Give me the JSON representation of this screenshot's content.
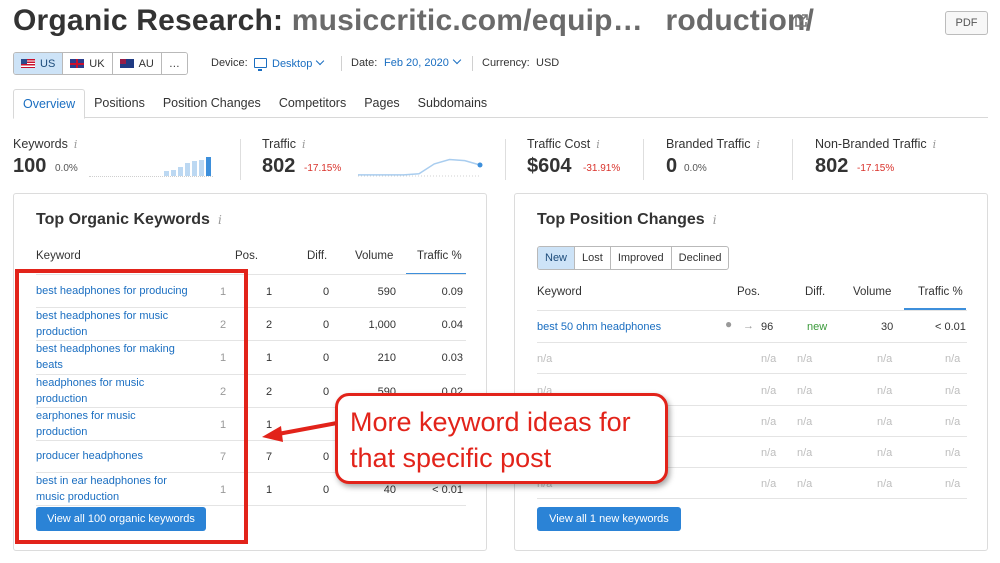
{
  "header": {
    "title_prefix": "Organic Research:",
    "title_domain": "musiccritic.com/equip…",
    "title_domain_end": "roduction/",
    "pdf_label": "PDF"
  },
  "filters": {
    "countries": [
      {
        "code": "US",
        "active": true
      },
      {
        "code": "UK",
        "active": false
      },
      {
        "code": "AU",
        "active": false
      },
      {
        "code": "…",
        "active": false
      }
    ],
    "device_label": "Device:",
    "device_value": "Desktop",
    "date_label": "Date:",
    "date_value": "Feb 20, 2020",
    "currency_label": "Currency:",
    "currency_value": "USD"
  },
  "tabs": [
    "Overview",
    "Positions",
    "Position Changes",
    "Competitors",
    "Pages",
    "Subdomains"
  ],
  "metrics": {
    "keywords": {
      "label": "Keywords",
      "value": "100",
      "delta": "0.0%"
    },
    "traffic": {
      "label": "Traffic",
      "value": "802",
      "delta": "-17.15%"
    },
    "traffic_cost": {
      "label": "Traffic Cost",
      "value": "$604",
      "delta": "-31.91%"
    },
    "branded": {
      "label": "Branded Traffic",
      "value": "0",
      "delta": "0.0%"
    },
    "non_branded": {
      "label": "Non-Branded Traffic",
      "value": "802",
      "delta": "-17.15%"
    }
  },
  "top_keywords": {
    "title": "Top Organic Keywords",
    "columns": {
      "keyword": "Keyword",
      "pos": "Pos.",
      "diff": "Diff.",
      "volume": "Volume",
      "traffic": "Traffic %"
    },
    "rows": [
      {
        "kw1": "best headphones for producing",
        "kw2": "",
        "prev": "1",
        "pos": "1",
        "diff": "0",
        "volume": "590",
        "traffic": "0.09"
      },
      {
        "kw1": "best headphones for music",
        "kw2": "production",
        "prev": "2",
        "pos": "2",
        "diff": "0",
        "volume": "1,000",
        "traffic": "0.04"
      },
      {
        "kw1": "best headphones for making",
        "kw2": "beats",
        "prev": "1",
        "pos": "1",
        "diff": "0",
        "volume": "210",
        "traffic": "0.03"
      },
      {
        "kw1": "headphones for music",
        "kw2": "production",
        "prev": "2",
        "pos": "2",
        "diff": "0",
        "volume": "590",
        "traffic": "0.02"
      },
      {
        "kw1": "earphones for music",
        "kw2": "production",
        "prev": "1",
        "pos": "1",
        "diff": "",
        "volume": "",
        "traffic": ""
      },
      {
        "kw1": "producer headphones",
        "kw2": "",
        "prev": "7",
        "pos": "7",
        "diff": "0",
        "volume": "",
        "traffic": ""
      },
      {
        "kw1": "best in ear headphones for",
        "kw2": "music production",
        "prev": "1",
        "pos": "1",
        "diff": "0",
        "volume": "40",
        "traffic": "< 0.01"
      }
    ],
    "view_all": "View all 100 organic keywords"
  },
  "position_changes": {
    "title": "Top Position Changes",
    "segments": [
      {
        "label": "New",
        "active": true
      },
      {
        "label": "Lost",
        "active": false
      },
      {
        "label": "Improved",
        "active": false
      },
      {
        "label": "Declined",
        "active": false
      }
    ],
    "columns": {
      "keyword": "Keyword",
      "pos": "Pos.",
      "diff": "Diff.",
      "volume": "Volume",
      "traffic": "Traffic %"
    },
    "first_row": {
      "keyword": "best 50 ohm headphones",
      "pos": "96",
      "diff": "new",
      "volume": "30",
      "traffic": "< 0.01"
    },
    "na": "n/a",
    "view_all": "View all 1 new keywords"
  },
  "annotation": {
    "line1": "More keyword ideas for",
    "line2": "that specific post",
    "color": "#e2231a"
  },
  "sparkline": {
    "keywords_bars": [
      0.25,
      0.3,
      0.45,
      0.6,
      0.7,
      0.75,
      0.9
    ],
    "traffic_points": [
      0.05,
      0.05,
      0.05,
      0.05,
      0.1,
      0.55,
      0.75,
      0.7,
      0.5
    ]
  }
}
